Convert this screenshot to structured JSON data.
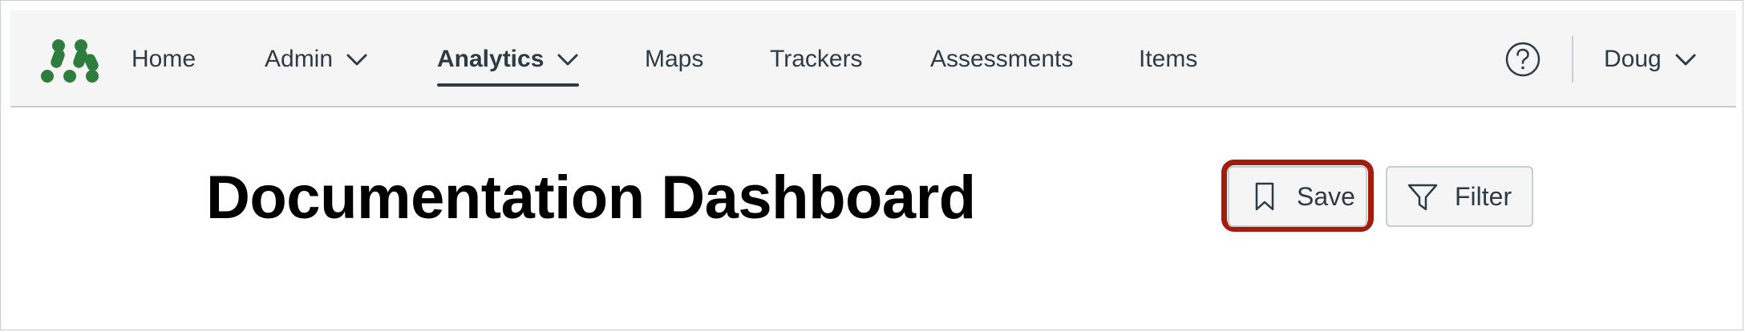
{
  "nav": {
    "items": [
      {
        "label": "Home"
      },
      {
        "label": "Admin"
      },
      {
        "label": "Analytics"
      },
      {
        "label": "Maps"
      },
      {
        "label": "Trackers"
      },
      {
        "label": "Assessments"
      },
      {
        "label": "Items"
      }
    ],
    "active_item": "Analytics",
    "user_label": "Doug"
  },
  "main": {
    "title": "Documentation Dashboard",
    "save_label": "Save",
    "filter_label": "Filter"
  },
  "colors": {
    "brand_green": "#2e7d3f",
    "highlight": "#a31c0c",
    "text": "#2d3b45"
  },
  "icons": {
    "logo": "brand-logo-dots",
    "help": "question-circle-icon",
    "save": "bookmark-icon",
    "filter": "funnel-icon",
    "dropdown": "chevron-down-icon"
  }
}
